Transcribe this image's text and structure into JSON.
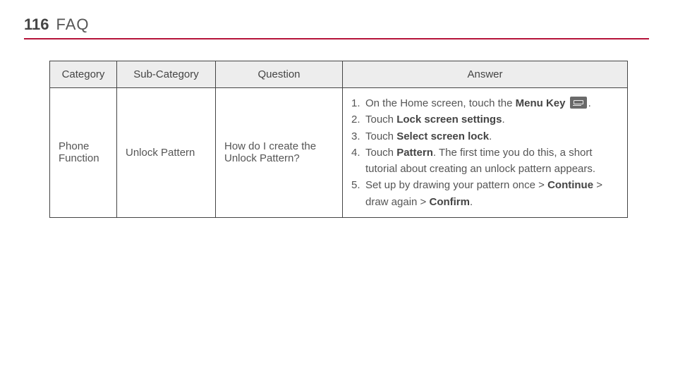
{
  "page_number": "116",
  "page_title": "FAQ",
  "headers": {
    "category": "Category",
    "sub_category": "Sub-Category",
    "question": "Question",
    "answer": "Answer"
  },
  "row": {
    "category": "Phone Function",
    "sub_category": "Unlock Pattern",
    "question": "How do I create the Unlock Pattern?",
    "answer_steps": {
      "s1_a": "On the Home screen, touch the ",
      "s1_b": "Menu Key",
      "s1_c": ".",
      "s2_a": "Touch ",
      "s2_b": "Lock screen settings",
      "s2_c": ".",
      "s3_a": "Touch ",
      "s3_b": "Select screen lock",
      "s3_c": ".",
      "s4_a": "Touch ",
      "s4_b": "Pattern",
      "s4_c": ". The first time you do this, a short tutorial about creating an unlock pattern appears.",
      "s5_a": "Set up by drawing your pattern once > ",
      "s5_b": "Continue",
      "s5_c": " > draw again > ",
      "s5_d": "Confirm",
      "s5_e": "."
    }
  }
}
